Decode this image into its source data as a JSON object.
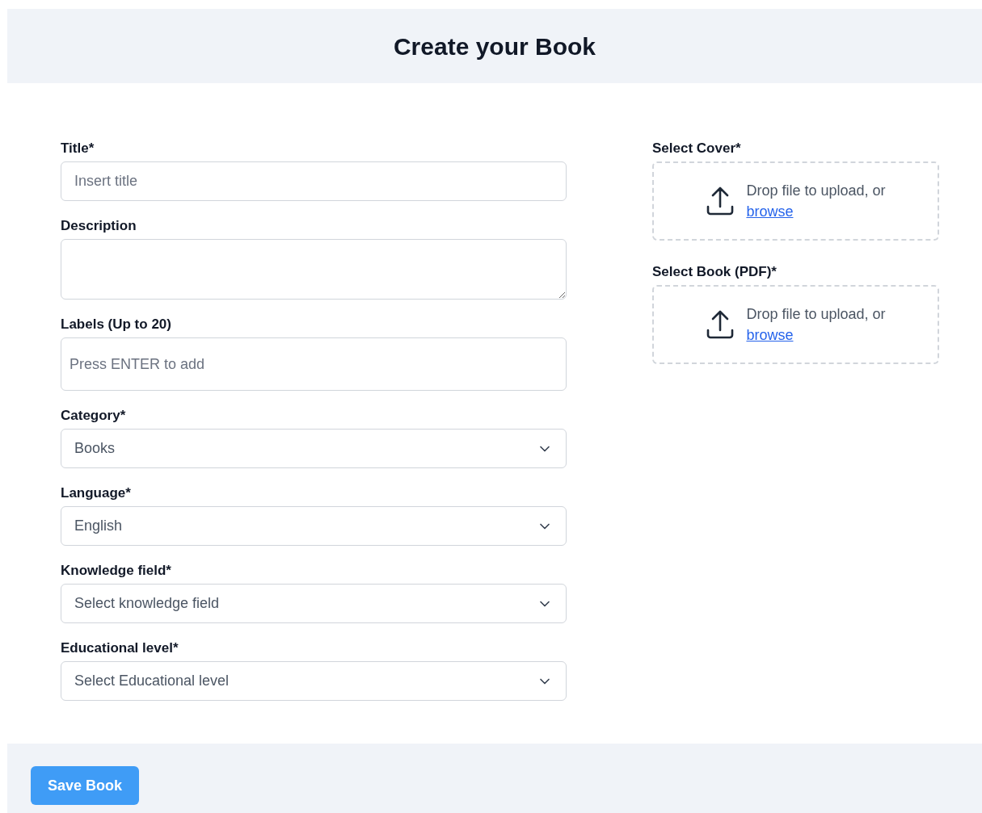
{
  "header": {
    "title": "Create your Book"
  },
  "fields": [
    {
      "kind": "input",
      "label": "Title*",
      "placeholder": "Insert title"
    },
    {
      "kind": "textarea",
      "label": "Description"
    },
    {
      "kind": "tags",
      "label": "Labels (Up to 20)",
      "placeholder": "Press ENTER to add"
    },
    {
      "kind": "select",
      "label": "Category*",
      "value": "Books"
    },
    {
      "kind": "select",
      "label": "Language*",
      "value": "English"
    },
    {
      "kind": "select",
      "label": "Knowledge field*",
      "value": "Select knowledge field"
    },
    {
      "kind": "select",
      "label": "Educational level*",
      "value": "Select Educational level"
    }
  ],
  "uploads": [
    {
      "label": "Select Cover*",
      "prompt": "Drop file to upload, or",
      "link": "browse"
    },
    {
      "label": "Select Book (PDF)*",
      "prompt": "Drop file to upload, or",
      "link": "browse"
    }
  ],
  "footer": {
    "button": "Save Book"
  }
}
